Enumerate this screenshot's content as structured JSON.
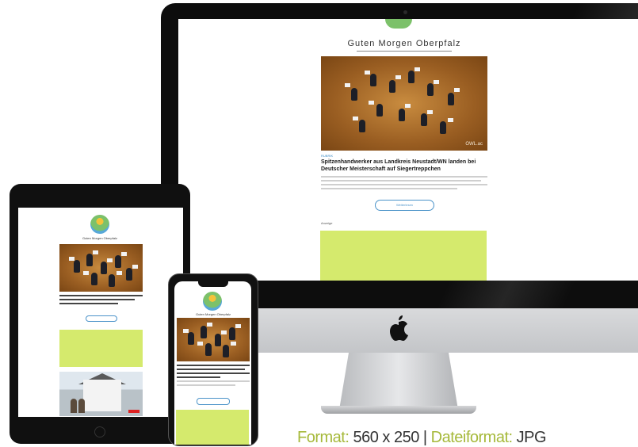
{
  "newsletter": {
    "title": "Guten Morgen Oberpfalz",
    "photo_credit": "OWL.ac",
    "kicker": "RUBRIK",
    "headline": "Spitzenhandwerker aus Landkreis Neustadt/WN landen bei Deutscher Meisterschaft auf Siegertreppchen",
    "button_label": "Weiterlesen",
    "ad_label": "Anzeige"
  },
  "caption": {
    "format_label": "Format:",
    "format_value": "560 x 250",
    "separator": "|",
    "fileformat_label": "Dateiformat:",
    "fileformat_value": "JPG"
  },
  "colors": {
    "ad_green": "#d5ea6d",
    "caption_label": "#a6b93a",
    "link_blue": "#4b93c9"
  },
  "icons": {
    "apple_logo": "apple-logo-icon"
  }
}
